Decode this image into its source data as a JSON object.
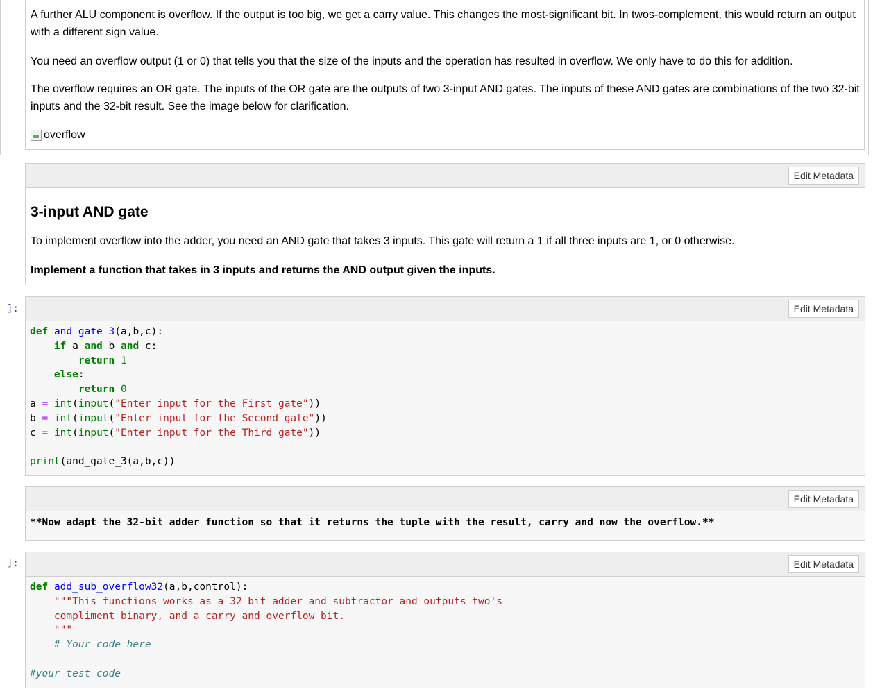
{
  "top_markdown": {
    "para1": "A further ALU component is overflow. If the output is too big, we get a carry value. This changes the most-significant bit. In twos-complement, this would return an output with a different sign value.",
    "para2": "You need an overflow output (1 or 0) that tells you that the size of the inputs and the operation has resulted in overflow. We only have to do this for addition.",
    "para3": "The overflow requires an OR gate. The inputs of the OR gate are the outputs of two 3-input AND gates. The inputs of these AND gates are combinations of the two 32-bit inputs and the 32-bit result. See the image below for clarification.",
    "image_alt": "overflow"
  },
  "edit_metadata_label": "Edit Metadata",
  "cell_and_heading": {
    "heading": "3-input AND gate",
    "para": "To implement overflow into the adder, you need an AND gate that takes 3 inputs. This gate will return a 1 if all three inputs are 1, or 0 otherwise.",
    "bold_para": "Implement a function that takes in 3 inputs and returns the AND output given the inputs."
  },
  "code_cell_1": {
    "prompt": "]:",
    "lines": [
      [
        {
          "t": "def",
          "c": "kw"
        },
        {
          "t": " "
        },
        {
          "t": "and_gate_3",
          "c": "fn"
        },
        {
          "t": "(a,b,c):"
        }
      ],
      [
        {
          "t": "    "
        },
        {
          "t": "if",
          "c": "kw"
        },
        {
          "t": " a "
        },
        {
          "t": "and",
          "c": "kw"
        },
        {
          "t": " b "
        },
        {
          "t": "and",
          "c": "kw"
        },
        {
          "t": " c:"
        }
      ],
      [
        {
          "t": "        "
        },
        {
          "t": "return",
          "c": "kw"
        },
        {
          "t": " "
        },
        {
          "t": "1",
          "c": "nm"
        }
      ],
      [
        {
          "t": "    "
        },
        {
          "t": "else",
          "c": "kw"
        },
        {
          "t": ":"
        }
      ],
      [
        {
          "t": "        "
        },
        {
          "t": "return",
          "c": "kw"
        },
        {
          "t": " "
        },
        {
          "t": "0",
          "c": "nm"
        }
      ],
      [
        {
          "t": "a "
        },
        {
          "t": "=",
          "c": "op"
        },
        {
          "t": " "
        },
        {
          "t": "int",
          "c": "bi"
        },
        {
          "t": "("
        },
        {
          "t": "input",
          "c": "bi"
        },
        {
          "t": "("
        },
        {
          "t": "\"Enter input for the First gate\"",
          "c": "st"
        },
        {
          "t": "))"
        }
      ],
      [
        {
          "t": "b "
        },
        {
          "t": "=",
          "c": "op"
        },
        {
          "t": " "
        },
        {
          "t": "int",
          "c": "bi"
        },
        {
          "t": "("
        },
        {
          "t": "input",
          "c": "bi"
        },
        {
          "t": "("
        },
        {
          "t": "\"Enter input for the Second gate\"",
          "c": "st"
        },
        {
          "t": "))"
        }
      ],
      [
        {
          "t": "c "
        },
        {
          "t": "=",
          "c": "op"
        },
        {
          "t": " "
        },
        {
          "t": "int",
          "c": "bi"
        },
        {
          "t": "("
        },
        {
          "t": "input",
          "c": "bi"
        },
        {
          "t": "("
        },
        {
          "t": "\"Enter input for the Third gate\"",
          "c": "st"
        },
        {
          "t": "))"
        }
      ],
      [
        {
          "t": ""
        }
      ],
      [
        {
          "t": "print",
          "c": "bi"
        },
        {
          "t": "(and_gate_3(a,b,c))"
        }
      ]
    ]
  },
  "raw_cell": {
    "text": "**Now adapt the 32-bit adder function so that it returns the tuple with the result, carry and now the overflow.**"
  },
  "code_cell_2": {
    "prompt": "]:",
    "lines": [
      [
        {
          "t": "def",
          "c": "kw"
        },
        {
          "t": " "
        },
        {
          "t": "add_sub_overflow32",
          "c": "fn"
        },
        {
          "t": "(a,b,control):"
        }
      ],
      [
        {
          "t": "    "
        },
        {
          "t": "\"\"\"This functions works as a 32 bit adder and subtractor and outputs two's",
          "c": "st"
        }
      ],
      [
        {
          "t": "    "
        },
        {
          "t": "compliment binary, and a carry and overflow bit.",
          "c": "st"
        }
      ],
      [
        {
          "t": "    "
        },
        {
          "t": "\"\"\"",
          "c": "st"
        }
      ],
      [
        {
          "t": "    "
        },
        {
          "t": "# Your code here",
          "c": "cm"
        }
      ],
      [
        {
          "t": ""
        }
      ],
      [
        {
          "t": "#your test code",
          "c": "cm"
        }
      ]
    ]
  }
}
